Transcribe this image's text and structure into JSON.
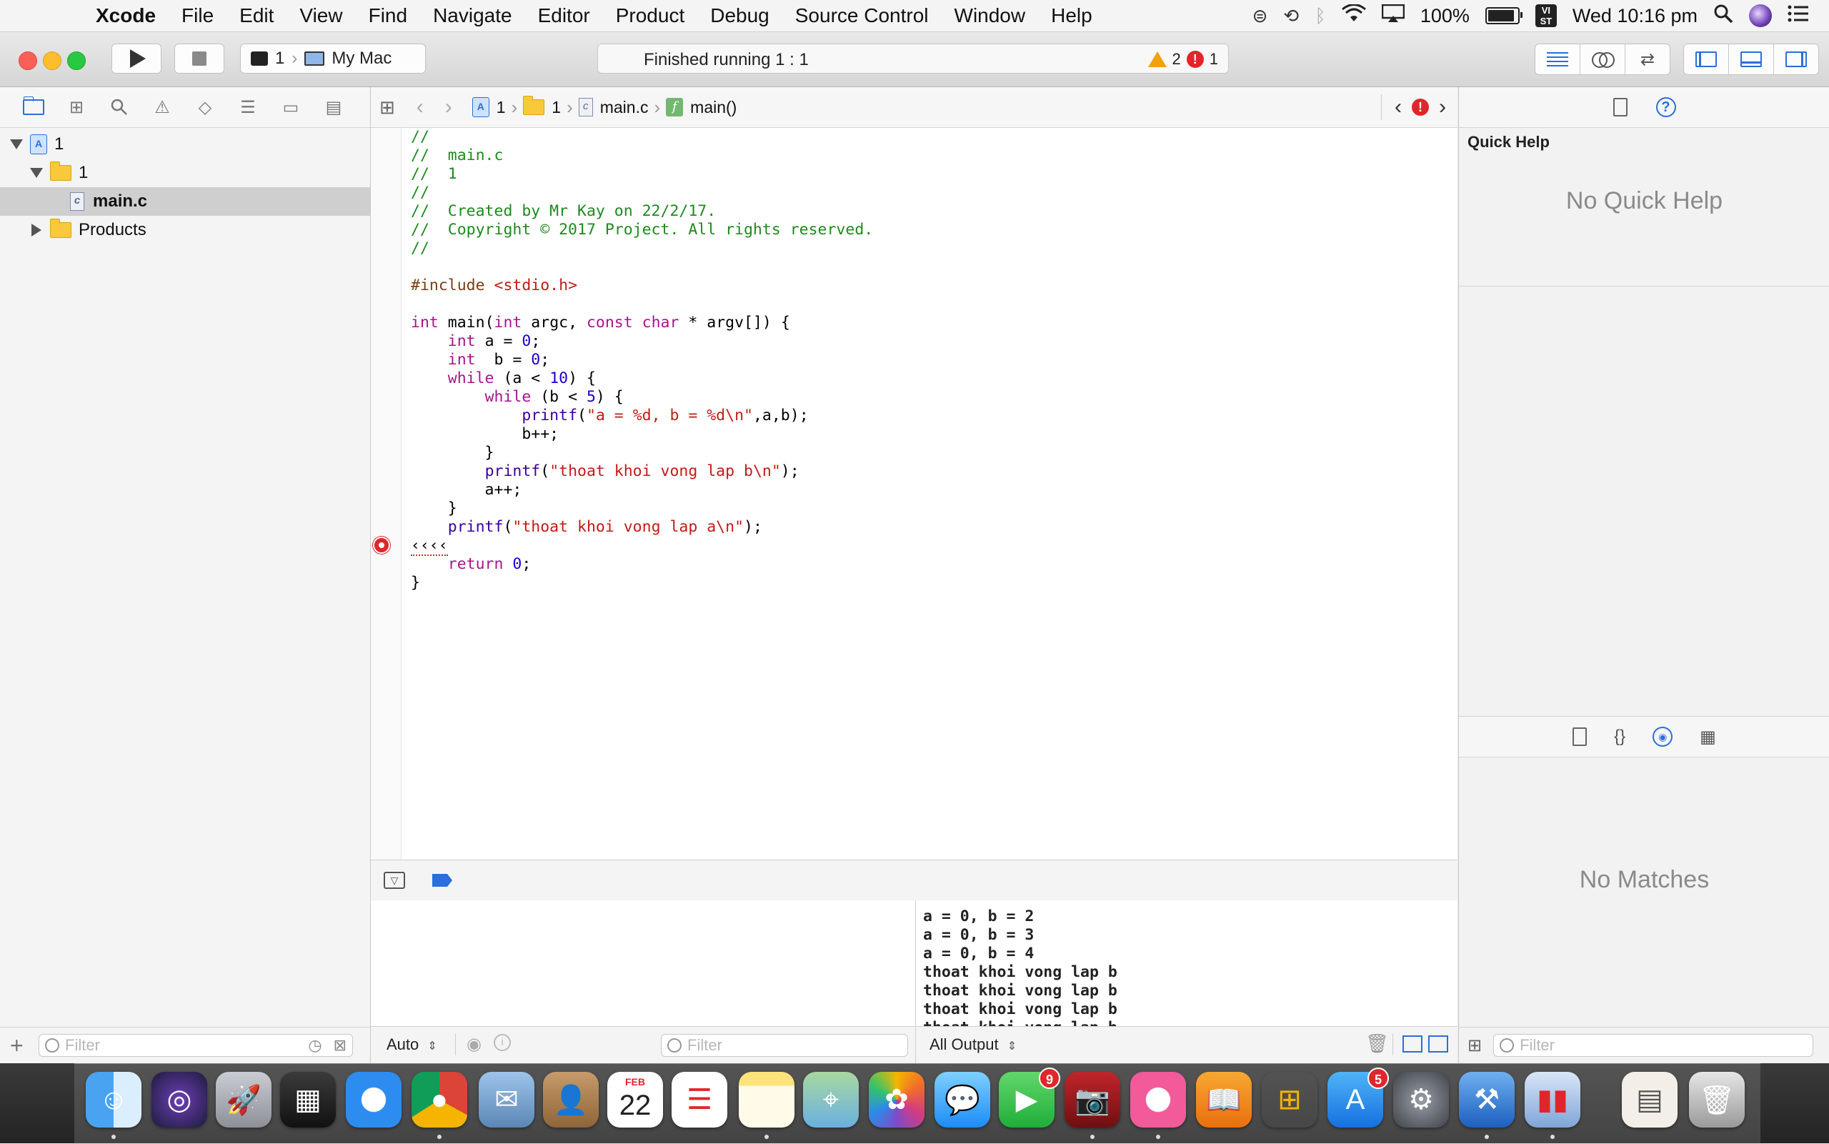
{
  "menubar": {
    "app": "Xcode",
    "items": [
      "File",
      "Edit",
      "View",
      "Find",
      "Navigate",
      "Editor",
      "Product",
      "Debug",
      "Source Control",
      "Window",
      "Help"
    ],
    "battery": "100%",
    "input_source": "VI\nST",
    "clock": "Wed 10:16 pm"
  },
  "toolbar": {
    "scheme_target": "1",
    "scheme_device": "My Mac",
    "status": "Finished running 1 : 1",
    "warning_count": "2",
    "error_count": "1"
  },
  "navigator": {
    "tree": [
      {
        "label": "1",
        "kind": "project",
        "level": 0
      },
      {
        "label": "1",
        "kind": "group",
        "level": 1
      },
      {
        "label": "main.c",
        "kind": "c-file",
        "level": 2,
        "selected": true
      },
      {
        "label": "Products",
        "kind": "group",
        "level": 1
      }
    ],
    "filter_placeholder": "Filter"
  },
  "jumpbar": {
    "project": "1",
    "group": "1",
    "file": "main.c",
    "symbol": "main()"
  },
  "editor": {
    "lines": [
      "//",
      "//  main.c",
      "//  1",
      "//",
      "//  Created by Mr Kay on 22/2/17.",
      "//  Copyright © 2017 Project. All rights reserved.",
      "//",
      "",
      "#include <stdio.h>",
      "",
      "int main(int argc, const char * argv[]) {",
      "    int a = 0;",
      "    int  b = 0;",
      "    while (a < 10) {",
      "        while (b < 5) {",
      "            printf(\"a = %d, b = %d\\n\",a,b);",
      "            b++;",
      "        }",
      "        printf(\"thoat khoi vong lap b\\n\");",
      "        a++;",
      "    }",
      "    printf(\"thoat khoi vong lap a\\n\");",
      "‹‹‹‹",
      "    return 0;",
      "}"
    ]
  },
  "debug": {
    "scope": "Auto",
    "filter_placeholder": "Filter",
    "output_selector": "All Output",
    "console_lines": [
      "a = 0, b = 2",
      "a = 0, b = 3",
      "a = 0, b = 4",
      "thoat khoi vong lap b",
      "thoat khoi vong lap b",
      "thoat khoi vong lap b",
      "thoat khoi vong lap b"
    ]
  },
  "inspector": {
    "quick_help_title": "Quick Help",
    "quick_help_empty": "No Quick Help",
    "library_empty": "No Matches",
    "filter_placeholder": "Filter"
  },
  "dock": {
    "calendar_month": "FEB",
    "calendar_day": "22",
    "facetime_badge": "9",
    "appstore_badge": "5"
  },
  "colors": {
    "accent": "#2a6fdb",
    "comment": "#1e8a1e",
    "keyword": "#a8148c",
    "string": "#c41a16",
    "number": "#1c00cf",
    "error": "#e0262b",
    "warning": "#f0a20a"
  }
}
